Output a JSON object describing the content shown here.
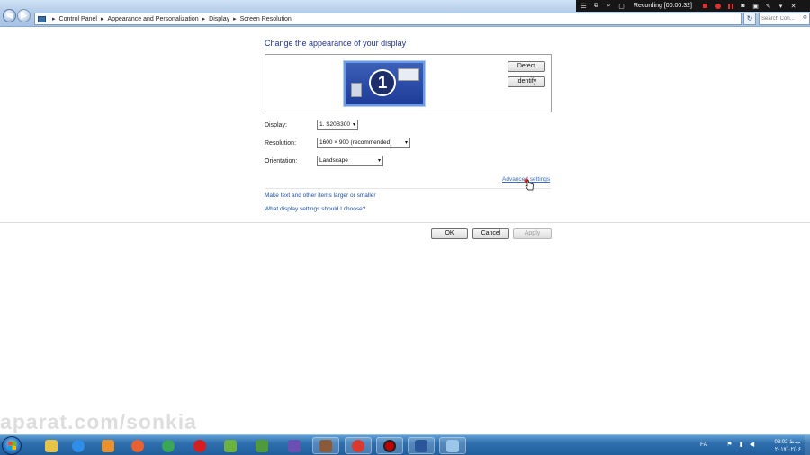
{
  "address": {
    "crumbs": [
      "Control Panel",
      "Appearance and Personalization",
      "Display",
      "Screen Resolution"
    ],
    "search_placeholder": "Search Con..."
  },
  "recorder": {
    "label": "Recording [00:00:32]"
  },
  "main": {
    "title": "Change the appearance of your display",
    "monitor_number": "1",
    "detect_label": "Detect",
    "identify_label": "Identify",
    "display_label": "Display:",
    "display_value": "1. S20B300",
    "resolution_label": "Resolution:",
    "resolution_value": "1600 × 900 (recommended)",
    "orientation_label": "Orientation:",
    "orientation_value": "Landscape",
    "advanced_link": "Advanced settings",
    "link_text_size": "Make text and other items larger or smaller",
    "link_which_settings": "What display settings should I choose?",
    "ok_label": "OK",
    "cancel_label": "Cancel",
    "apply_label": "Apply"
  },
  "watermark": "aparat.com/sonkia",
  "taskbar": {
    "apps": [
      "windows-explorer",
      "internet-explorer",
      "media-player",
      "firefox",
      "chrome",
      "opera",
      "greenshot",
      "green-app",
      "visual-studio",
      "contact",
      "google-chrome",
      "record-app",
      "microsoft-word",
      "remote-desktop"
    ],
    "language": "FA",
    "clock_time": "08:02 ب.ظ",
    "clock_date": "۲۰۱۷/۰۲/۰۶"
  },
  "colors": {
    "title_blue": "#1e3287",
    "link_blue": "#1e50a2",
    "taskbar": "#2f6fae",
    "record_red": "#e23030"
  }
}
